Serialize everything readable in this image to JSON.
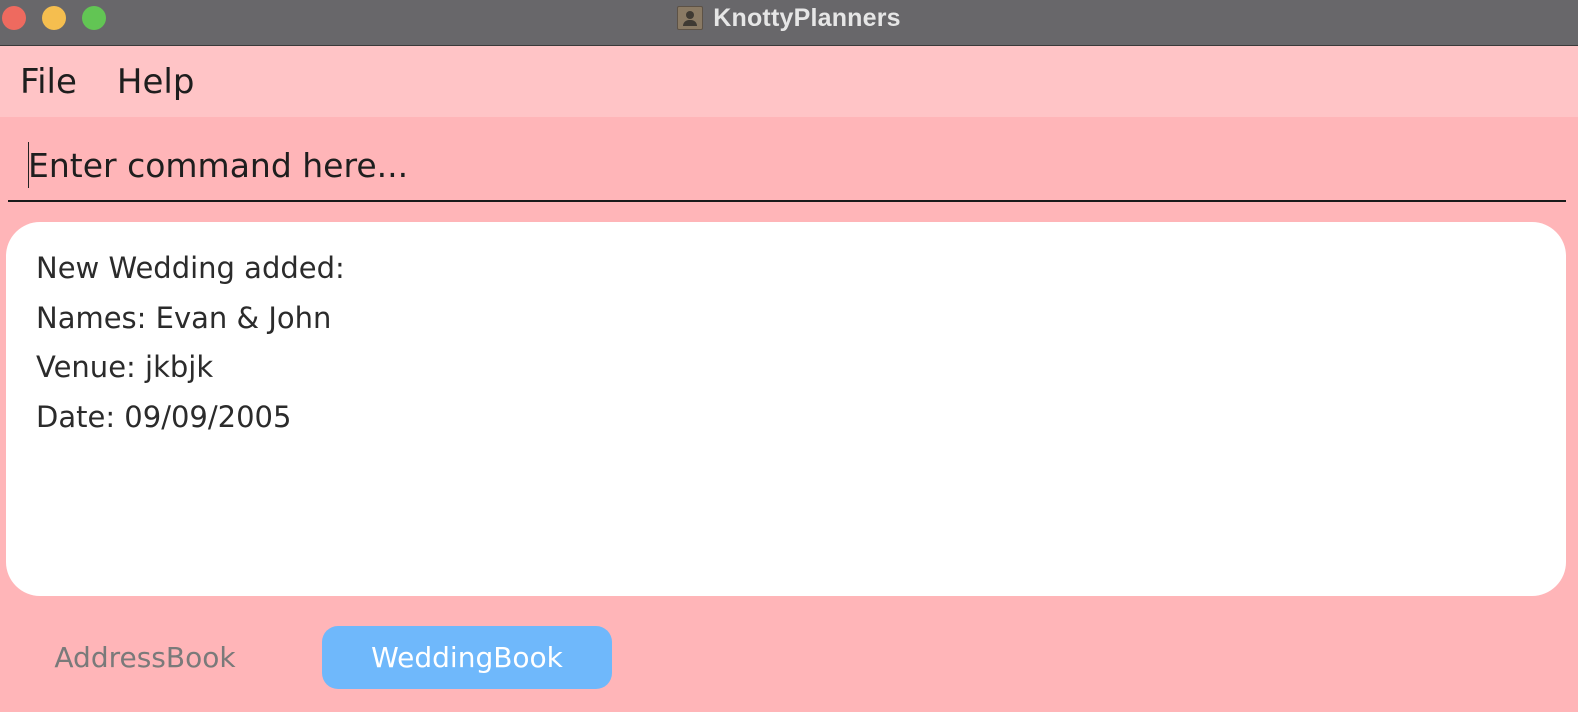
{
  "window": {
    "title": "KnottyPlanners",
    "app_icon": "contact-card-icon"
  },
  "menu": {
    "items": [
      {
        "label": "File"
      },
      {
        "label": "Help"
      }
    ]
  },
  "command": {
    "placeholder": "Enter command here...",
    "value": ""
  },
  "result": {
    "lines": [
      "New Wedding added:",
      "Names: Evan & John",
      "Venue: jkbjk",
      "Date: 09/09/2005"
    ]
  },
  "tabs": {
    "items": [
      {
        "label": "AddressBook",
        "selected": false
      },
      {
        "label": "WeddingBook",
        "selected": true
      }
    ]
  },
  "colors": {
    "background": "#ffb5b8",
    "menubar": "#ffc4c6",
    "selected_tab": "#6fb8fb",
    "titlebar": "#68676a"
  }
}
